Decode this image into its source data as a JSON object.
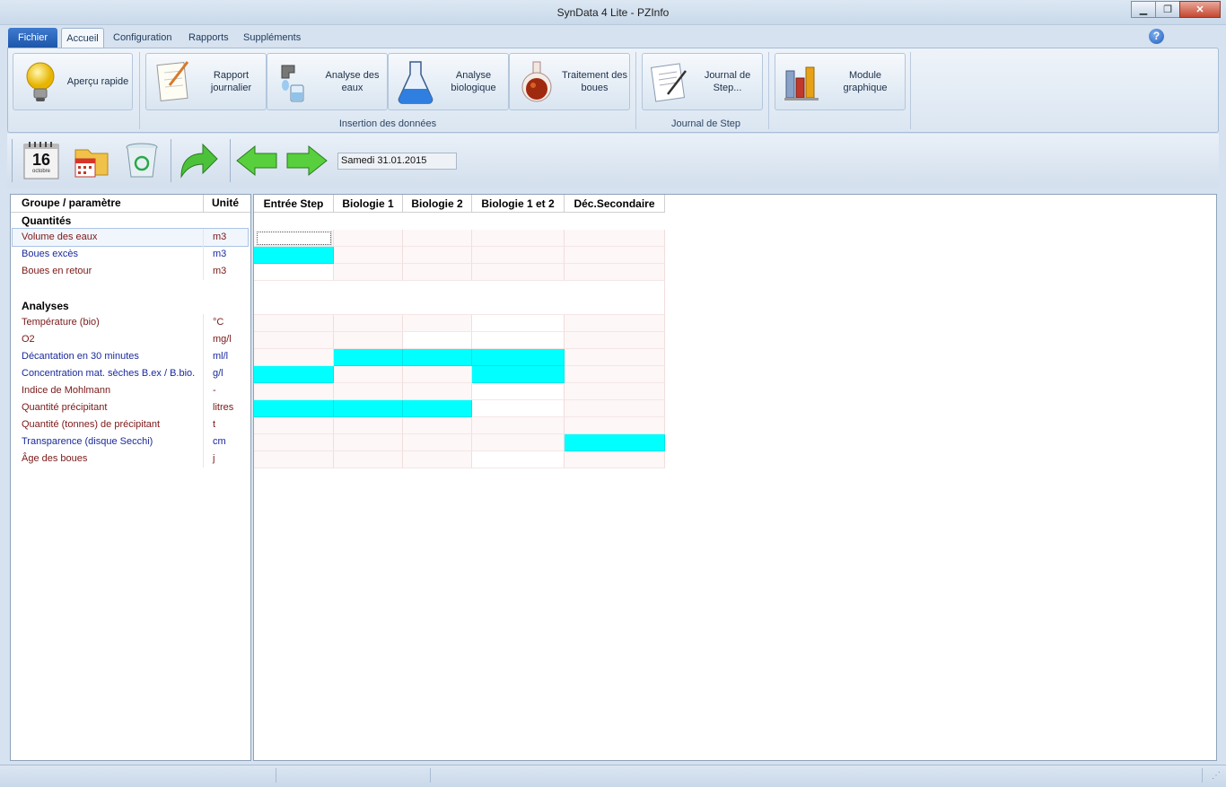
{
  "window": {
    "title": "SynData 4 Lite - PZInfo"
  },
  "tabs": {
    "fichier": "Fichier",
    "accueil": "Accueil",
    "configuration": "Configuration",
    "rapports": "Rapports",
    "supplements": "Suppléments"
  },
  "ribbon": {
    "apercu": "Aperçu rapide",
    "rapport": "Rapport journalier",
    "analyse_eaux": "Analyse des eaux",
    "analyse_bio": "Analyse biologique",
    "traitement": "Traitement des boues",
    "journal": "Journal de Step...",
    "module": "Module graphique",
    "group_insertion": "Insertion des données",
    "group_journal": "Journal de Step"
  },
  "toolbar": {
    "calendar_day": "16",
    "calendar_month": "octobre",
    "date": "Samedi 31.01.2015"
  },
  "left": {
    "header_param": "Groupe / paramètre",
    "header_unit": "Unité",
    "group_quantites": "Quantités",
    "group_analyses": "Analyses",
    "quantites": [
      {
        "p": "Volume des eaux",
        "u": "m3"
      },
      {
        "p": "Boues excès",
        "u": "m3"
      },
      {
        "p": "Boues en retour",
        "u": "m3"
      }
    ],
    "analyses": [
      {
        "p": "Température (bio)",
        "u": "°C"
      },
      {
        "p": "O2",
        "u": "mg/l"
      },
      {
        "p": "Décantation en 30 minutes",
        "u": "ml/l"
      },
      {
        "p": "Concentration mat. sèches  B.ex / B.bio.",
        "u": "g/l"
      },
      {
        "p": "Indice de Mohlmann",
        "u": "-"
      },
      {
        "p": "Quantité précipitant",
        "u": "litres"
      },
      {
        "p": "Quantité (tonnes) de précipitant",
        "u": "t"
      },
      {
        "p": "Transparence (disque Secchi)",
        "u": "cm"
      },
      {
        "p": "Âge des boues",
        "u": "j"
      }
    ]
  },
  "grid": {
    "columns": [
      "Entrée Step",
      "Biologie 1",
      "Biologie 2",
      "Biologie 1 et 2",
      "Déc.Secondaire"
    ]
  },
  "colors": {
    "highlight": "#00ffff",
    "param_red": "#7a1818",
    "param_blue": "#1a2a9c"
  }
}
